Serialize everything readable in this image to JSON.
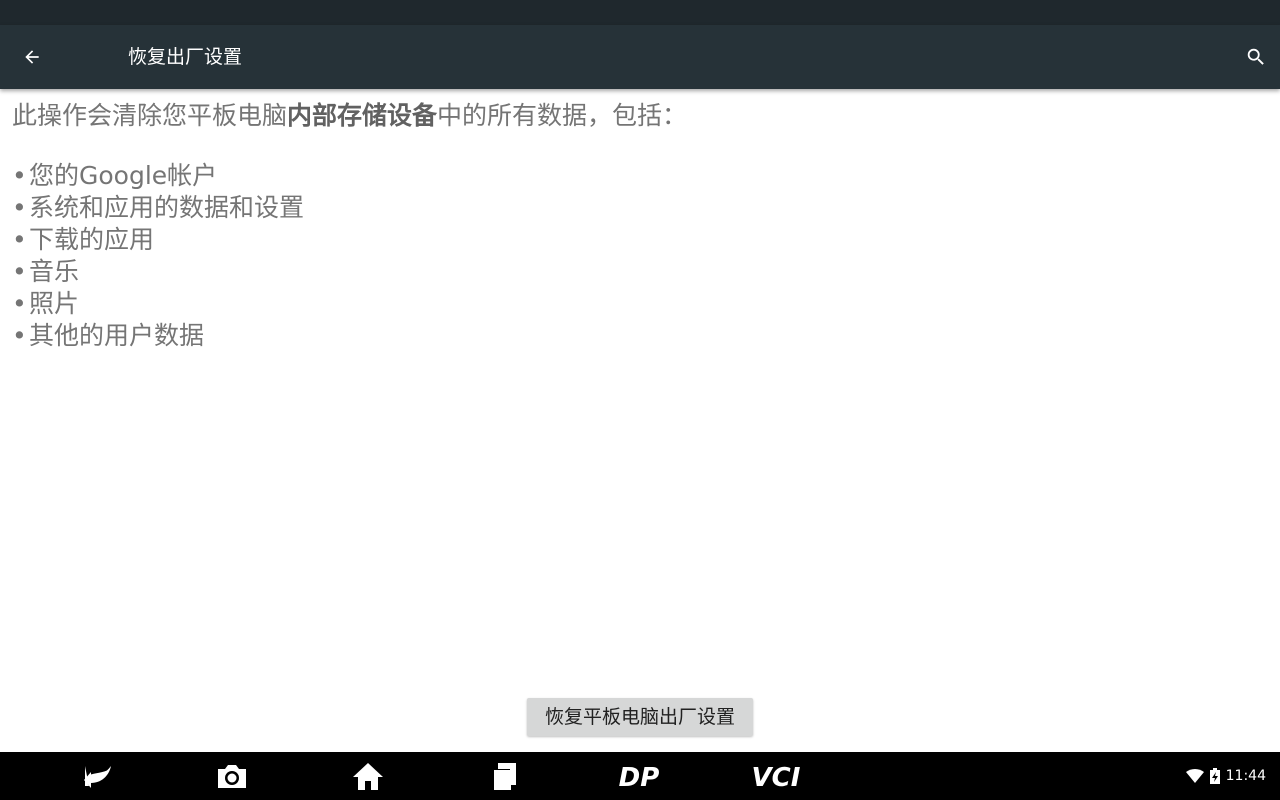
{
  "action_bar": {
    "back_icon": "arrow-left-icon",
    "title": "恢复出厂设置",
    "search_icon": "search-icon",
    "background": "#263238"
  },
  "content": {
    "intro_prefix": "此操作会清除您平板电脑",
    "intro_bold": "内部存储设备",
    "intro_suffix": "中的所有数据，包括：",
    "bullet": "•",
    "items": [
      "您的Google帐户",
      "系统和应用的数据和设置",
      "下载的应用",
      "音乐",
      "照片",
      "其他的用户数据"
    ]
  },
  "reset_button": {
    "label": "恢复平板电脑出厂设置"
  },
  "nav_bar": {
    "icons": [
      "back-icon",
      "camera-icon",
      "home-icon",
      "recents-icon",
      "dp-logo-icon",
      "vci-logo-icon"
    ],
    "dp_label": "DP",
    "vci_label": "VCI"
  },
  "status": {
    "time": "11:44",
    "icons": [
      "wifi-icon",
      "battery-charging-icon"
    ]
  }
}
